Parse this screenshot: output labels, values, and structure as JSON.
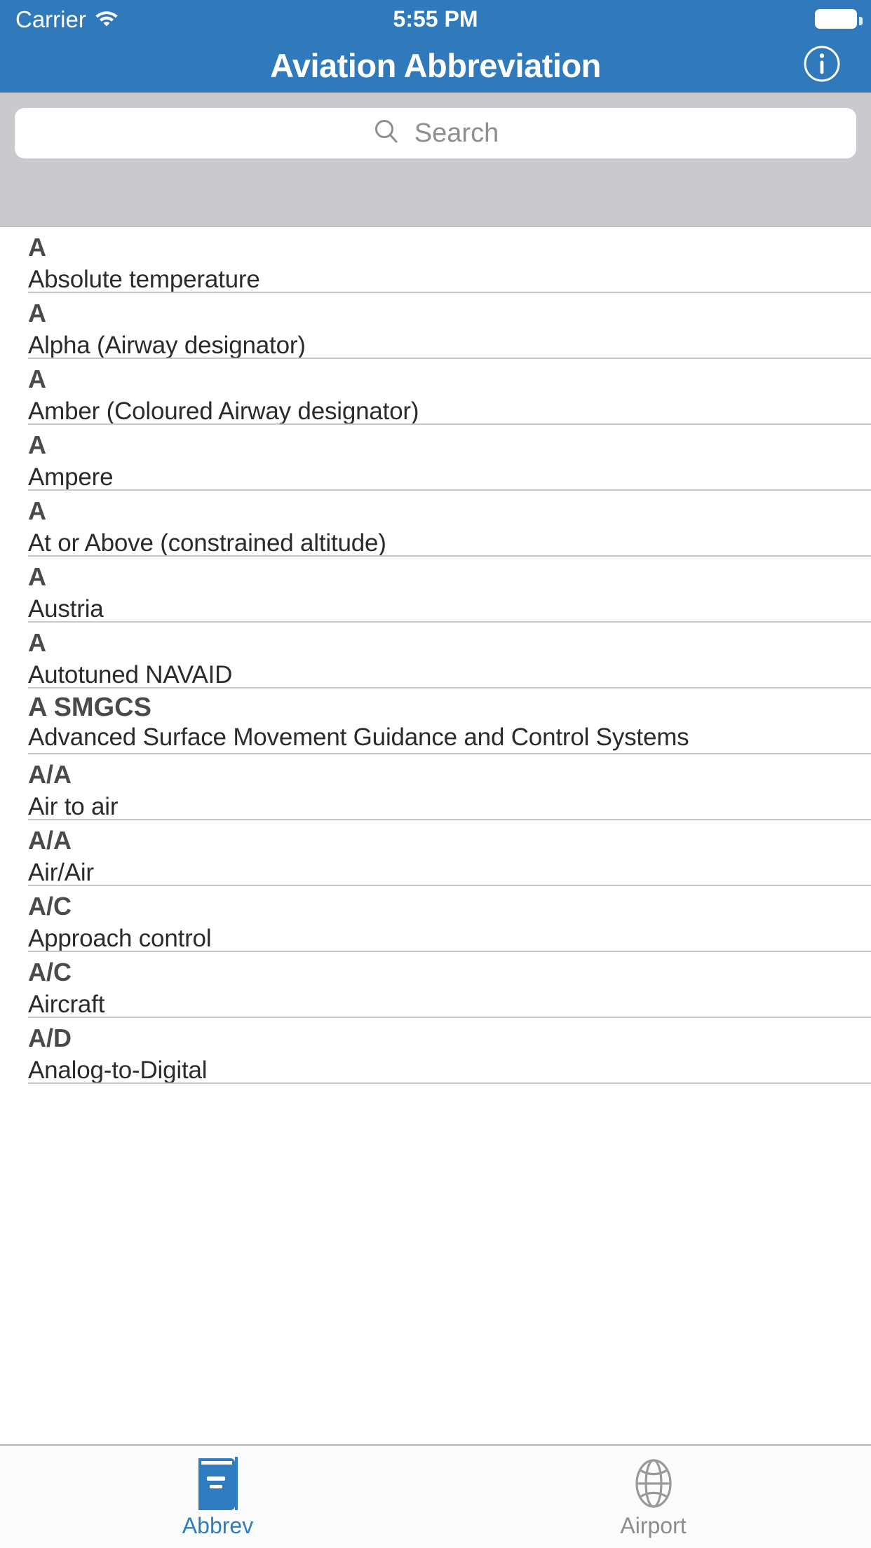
{
  "status_bar": {
    "carrier": "Carrier",
    "wifi_icon": "wifi-icon",
    "time": "5:55 PM",
    "battery_icon": "battery-full-icon"
  },
  "nav_bar": {
    "title": "Aviation Abbreviation",
    "info_button": {
      "icon": "info-circle-icon",
      "label": "Info"
    },
    "background_color": "#3079bb"
  },
  "search": {
    "placeholder": "Search",
    "value": "",
    "icon": "search-icon",
    "band_color": "#c9c9ce"
  },
  "list": {
    "rows": [
      {
        "abbr": "A",
        "desc": "Absolute temperature"
      },
      {
        "abbr": "A",
        "desc": "Alpha (Airway designator)"
      },
      {
        "abbr": "A",
        "desc": "Amber (Coloured Airway designator)"
      },
      {
        "abbr": "A",
        "desc": "Ampere"
      },
      {
        "abbr": "A",
        "desc": "At or Above (constrained altitude)"
      },
      {
        "abbr": "A",
        "desc": "Austria"
      },
      {
        "abbr": "A",
        "desc": "Autotuned NAVAID"
      },
      {
        "abbr": "A SMGCS",
        "desc": "Advanced Surface Movement Guidance and Control Systems"
      },
      {
        "abbr": "A/A",
        "desc": "Air to air"
      },
      {
        "abbr": "A/A",
        "desc": "Air/Air"
      },
      {
        "abbr": "A/C",
        "desc": "Approach control"
      },
      {
        "abbr": "A/C",
        "desc": "Aircraft"
      },
      {
        "abbr": "A/D",
        "desc": "Analog-to-Digital"
      }
    ]
  },
  "tab_bar": {
    "active_color": "#2f7dc0",
    "inactive_color": "#8d8d8d",
    "tabs": [
      {
        "label": "Abbrev",
        "icon": "book-icon",
        "active": true
      },
      {
        "label": "Airport",
        "icon": "globe-icon",
        "active": false
      }
    ]
  }
}
